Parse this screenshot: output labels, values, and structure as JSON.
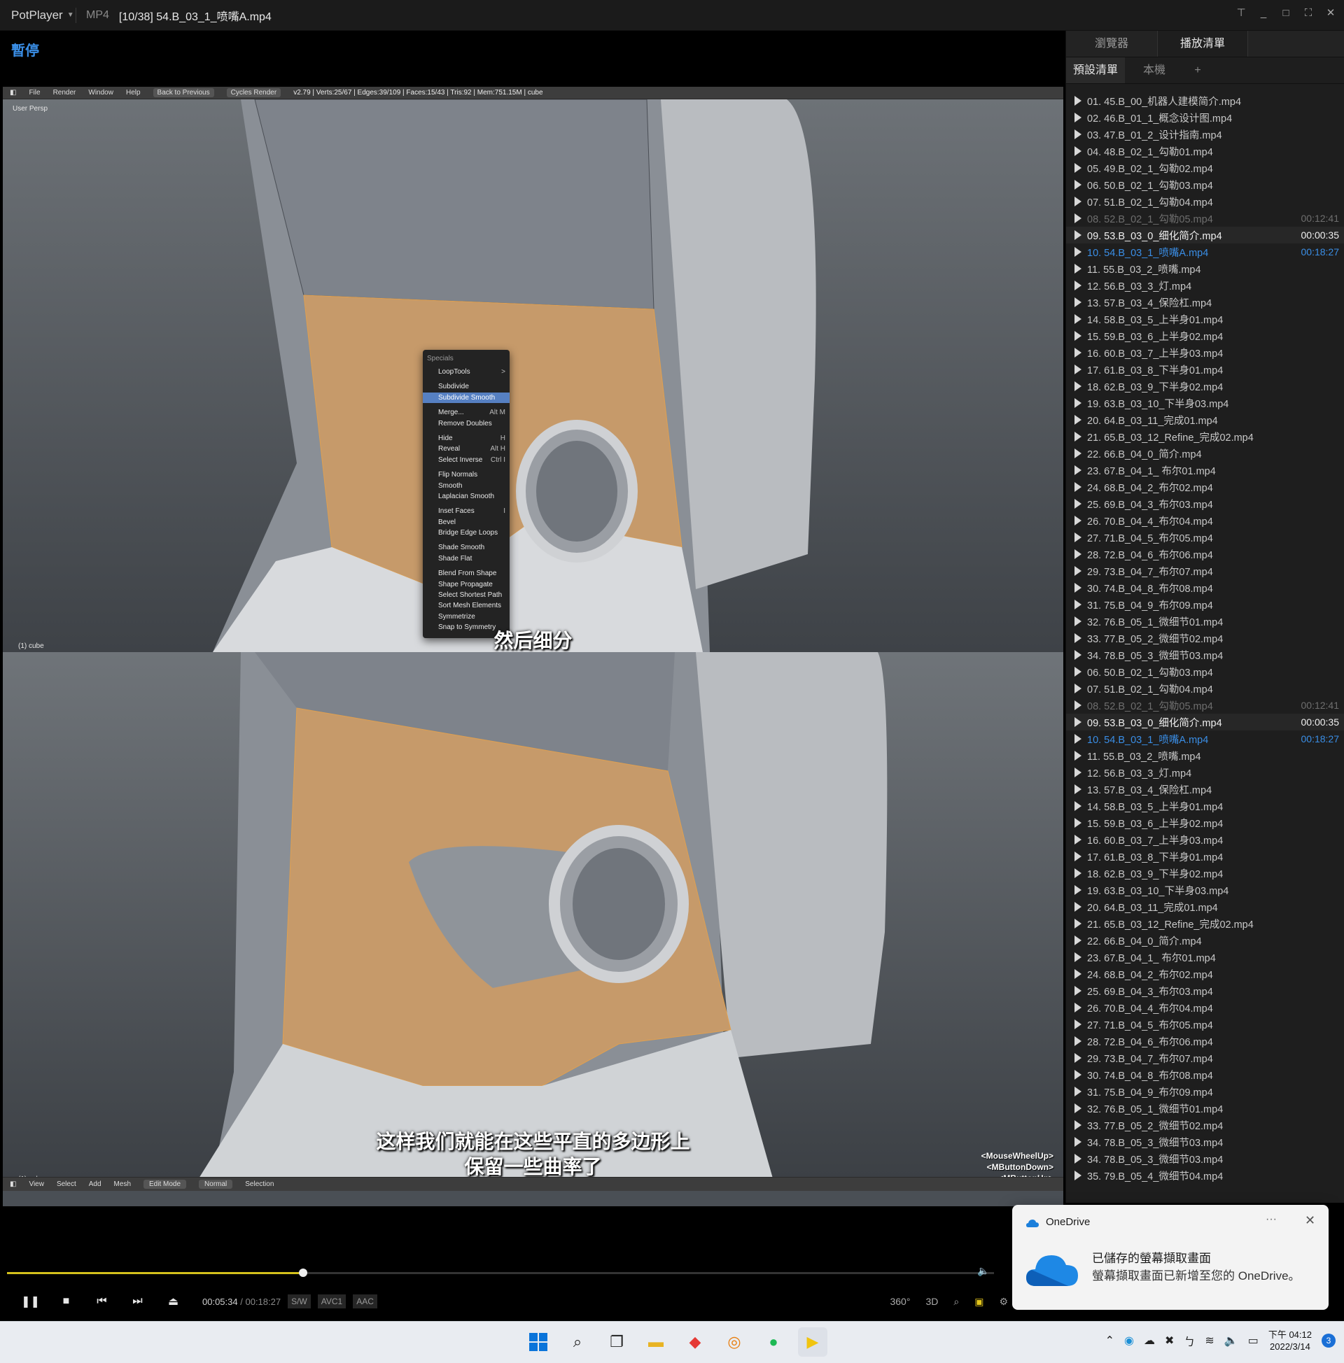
{
  "window": {
    "app_name": "PotPlayer",
    "format": "MP4",
    "title": "[10/38] 54.B_03_1_喷嘴A.mp4"
  },
  "video": {
    "pause_label": "暫停",
    "blender_header": {
      "menus": [
        "File",
        "Render",
        "Window",
        "Help"
      ],
      "back_button": "Back to Previous",
      "render_engine": "Cycles Render",
      "stats": "v2.79 | Verts:25/67 | Edges:39/109 | Faces:15/43 | Tris:92 | Mem:751.15M | cube"
    },
    "viewport_label": "User Persp",
    "object_label": "(1) cube",
    "specials_menu": {
      "title": "Specials",
      "items": [
        {
          "label": "LoopTools",
          "shortcut": ">",
          "gap": false,
          "highlight": false
        },
        {
          "label": "Subdivide",
          "shortcut": "",
          "gap": true,
          "highlight": false
        },
        {
          "label": "Subdivide Smooth",
          "shortcut": "",
          "gap": false,
          "highlight": true
        },
        {
          "label": "Merge...",
          "shortcut": "Alt M",
          "gap": true,
          "highlight": false
        },
        {
          "label": "Remove Doubles",
          "shortcut": "",
          "gap": false,
          "highlight": false
        },
        {
          "label": "Hide",
          "shortcut": "H",
          "gap": true,
          "highlight": false
        },
        {
          "label": "Reveal",
          "shortcut": "Alt H",
          "gap": false,
          "highlight": false
        },
        {
          "label": "Select Inverse",
          "shortcut": "Ctrl I",
          "gap": false,
          "highlight": false
        },
        {
          "label": "Flip Normals",
          "shortcut": "",
          "gap": true,
          "highlight": false
        },
        {
          "label": "Smooth",
          "shortcut": "",
          "gap": false,
          "highlight": false
        },
        {
          "label": "Laplacian Smooth",
          "shortcut": "",
          "gap": false,
          "highlight": false
        },
        {
          "label": "Inset Faces",
          "shortcut": "I",
          "gap": true,
          "highlight": false
        },
        {
          "label": "Bevel",
          "shortcut": "",
          "gap": false,
          "highlight": false
        },
        {
          "label": "Bridge Edge Loops",
          "shortcut": "",
          "gap": false,
          "highlight": false
        },
        {
          "label": "Shade Smooth",
          "shortcut": "",
          "gap": true,
          "highlight": false
        },
        {
          "label": "Shade Flat",
          "shortcut": "",
          "gap": false,
          "highlight": false
        },
        {
          "label": "Blend From Shape",
          "shortcut": "",
          "gap": true,
          "highlight": false
        },
        {
          "label": "Shape Propagate",
          "shortcut": "",
          "gap": false,
          "highlight": false
        },
        {
          "label": "Select Shortest Path",
          "shortcut": "",
          "gap": false,
          "highlight": false
        },
        {
          "label": "Sort Mesh Elements",
          "shortcut": "",
          "gap": false,
          "highlight": false
        },
        {
          "label": "Symmetrize",
          "shortcut": "",
          "gap": false,
          "highlight": false
        },
        {
          "label": "Snap to Symmetry",
          "shortcut": "",
          "gap": false,
          "highlight": false
        }
      ]
    },
    "subtitle_top": "然后细分",
    "subtitle_bottom_1": "这样我们就能在这些平直的多边形上",
    "subtitle_bottom_2": "保留一些曲率了",
    "keylog": [
      "<MouseWheelUp>",
      "<MButtonDown>",
      "<MButtonUp>"
    ],
    "blender_footer": {
      "items": [
        "View",
        "Select",
        "Add",
        "Mesh"
      ],
      "mode": "Edit Mode",
      "orientation": "Normal",
      "selection": "Selection"
    }
  },
  "sidebar": {
    "tabs": [
      "瀏覽器",
      "播放清單"
    ],
    "sub_tabs": [
      "預設清單",
      "本機",
      "+"
    ],
    "playlist": [
      {
        "name": "01. 45.B_00_机器人建模简介.mp4",
        "dur": "",
        "state": ""
      },
      {
        "name": "02. 46.B_01_1_概念设计图.mp4",
        "dur": "",
        "state": ""
      },
      {
        "name": "03. 47.B_01_2_设计指南.mp4",
        "dur": "",
        "state": ""
      },
      {
        "name": "04. 48.B_02_1_勾勒01.mp4",
        "dur": "",
        "state": ""
      },
      {
        "name": "05. 49.B_02_1_勾勒02.mp4",
        "dur": "",
        "state": ""
      },
      {
        "name": "06. 50.B_02_1_勾勒03.mp4",
        "dur": "",
        "state": ""
      },
      {
        "name": "07. 51.B_02_1_勾勒04.mp4",
        "dur": "",
        "state": ""
      },
      {
        "name": "08. 52.B_02_1_勾勒05.mp4",
        "dur": "00:12:41",
        "state": "dim"
      },
      {
        "name": "09. 53.B_03_0_细化简介.mp4",
        "dur": "00:00:35",
        "state": "hi"
      },
      {
        "name": "10. 54.B_03_1_喷嘴A.mp4",
        "dur": "00:18:27",
        "state": "cur"
      },
      {
        "name": "11. 55.B_03_2_喷嘴.mp4",
        "dur": "",
        "state": ""
      },
      {
        "name": "12. 56.B_03_3_灯.mp4",
        "dur": "",
        "state": ""
      },
      {
        "name": "13. 57.B_03_4_保险杠.mp4",
        "dur": "",
        "state": ""
      },
      {
        "name": "14. 58.B_03_5_上半身01.mp4",
        "dur": "",
        "state": ""
      },
      {
        "name": "15. 59.B_03_6_上半身02.mp4",
        "dur": "",
        "state": ""
      },
      {
        "name": "16. 60.B_03_7_上半身03.mp4",
        "dur": "",
        "state": ""
      },
      {
        "name": "17. 61.B_03_8_下半身01.mp4",
        "dur": "",
        "state": ""
      },
      {
        "name": "18. 62.B_03_9_下半身02.mp4",
        "dur": "",
        "state": ""
      },
      {
        "name": "19. 63.B_03_10_下半身03.mp4",
        "dur": "",
        "state": ""
      },
      {
        "name": "20. 64.B_03_11_完成01.mp4",
        "dur": "",
        "state": ""
      },
      {
        "name": "21. 65.B_03_12_Refine_完成02.mp4",
        "dur": "",
        "state": ""
      },
      {
        "name": "22. 66.B_04_0_简介.mp4",
        "dur": "",
        "state": ""
      },
      {
        "name": "23. 67.B_04_1_ 布尔01.mp4",
        "dur": "",
        "state": ""
      },
      {
        "name": "24. 68.B_04_2_布尔02.mp4",
        "dur": "",
        "state": ""
      },
      {
        "name": "25. 69.B_04_3_布尔03.mp4",
        "dur": "",
        "state": ""
      },
      {
        "name": "26. 70.B_04_4_布尔04.mp4",
        "dur": "",
        "state": ""
      },
      {
        "name": "27. 71.B_04_5_布尔05.mp4",
        "dur": "",
        "state": ""
      },
      {
        "name": "28. 72.B_04_6_布尔06.mp4",
        "dur": "",
        "state": ""
      },
      {
        "name": "29. 73.B_04_7_布尔07.mp4",
        "dur": "",
        "state": ""
      },
      {
        "name": "30. 74.B_04_8_布尔08.mp4",
        "dur": "",
        "state": ""
      },
      {
        "name": "31. 75.B_04_9_布尔09.mp4",
        "dur": "",
        "state": ""
      },
      {
        "name": "32. 76.B_05_1_微细节01.mp4",
        "dur": "",
        "state": ""
      },
      {
        "name": "33. 77.B_05_2_微细节02.mp4",
        "dur": "",
        "state": ""
      },
      {
        "name": "34. 78.B_05_3_微细节03.mp4",
        "dur": "",
        "state": ""
      },
      {
        "name": "06. 50.B_02_1_勾勒03.mp4",
        "dur": "",
        "state": ""
      },
      {
        "name": "07. 51.B_02_1_勾勒04.mp4",
        "dur": "",
        "state": ""
      },
      {
        "name": "08. 52.B_02_1_勾勒05.mp4",
        "dur": "00:12:41",
        "state": "dim"
      },
      {
        "name": "09. 53.B_03_0_细化简介.mp4",
        "dur": "00:00:35",
        "state": "hi"
      },
      {
        "name": "10. 54.B_03_1_喷嘴A.mp4",
        "dur": "00:18:27",
        "state": "cur"
      },
      {
        "name": "11. 55.B_03_2_喷嘴.mp4",
        "dur": "",
        "state": ""
      },
      {
        "name": "12. 56.B_03_3_灯.mp4",
        "dur": "",
        "state": ""
      },
      {
        "name": "13. 57.B_03_4_保险杠.mp4",
        "dur": "",
        "state": ""
      },
      {
        "name": "14. 58.B_03_5_上半身01.mp4",
        "dur": "",
        "state": ""
      },
      {
        "name": "15. 59.B_03_6_上半身02.mp4",
        "dur": "",
        "state": ""
      },
      {
        "name": "16. 60.B_03_7_上半身03.mp4",
        "dur": "",
        "state": ""
      },
      {
        "name": "17. 61.B_03_8_下半身01.mp4",
        "dur": "",
        "state": ""
      },
      {
        "name": "18. 62.B_03_9_下半身02.mp4",
        "dur": "",
        "state": ""
      },
      {
        "name": "19. 63.B_03_10_下半身03.mp4",
        "dur": "",
        "state": ""
      },
      {
        "name": "20. 64.B_03_11_完成01.mp4",
        "dur": "",
        "state": ""
      },
      {
        "name": "21. 65.B_03_12_Refine_完成02.mp4",
        "dur": "",
        "state": ""
      },
      {
        "name": "22. 66.B_04_0_简介.mp4",
        "dur": "",
        "state": ""
      },
      {
        "name": "23. 67.B_04_1_ 布尔01.mp4",
        "dur": "",
        "state": ""
      },
      {
        "name": "24. 68.B_04_2_布尔02.mp4",
        "dur": "",
        "state": ""
      },
      {
        "name": "25. 69.B_04_3_布尔03.mp4",
        "dur": "",
        "state": ""
      },
      {
        "name": "26. 70.B_04_4_布尔04.mp4",
        "dur": "",
        "state": ""
      },
      {
        "name": "27. 71.B_04_5_布尔05.mp4",
        "dur": "",
        "state": ""
      },
      {
        "name": "28. 72.B_04_6_布尔06.mp4",
        "dur": "",
        "state": ""
      },
      {
        "name": "29. 73.B_04_7_布尔07.mp4",
        "dur": "",
        "state": ""
      },
      {
        "name": "30. 74.B_04_8_布尔08.mp4",
        "dur": "",
        "state": ""
      },
      {
        "name": "31. 75.B_04_9_布尔09.mp4",
        "dur": "",
        "state": ""
      },
      {
        "name": "32. 76.B_05_1_微细节01.mp4",
        "dur": "",
        "state": ""
      },
      {
        "name": "33. 77.B_05_2_微细节02.mp4",
        "dur": "",
        "state": ""
      },
      {
        "name": "34. 78.B_05_3_微细节03.mp4",
        "dur": "",
        "state": ""
      },
      {
        "name": "34. 78.B_05_3_微细节03.mp4",
        "dur": "",
        "state": ""
      },
      {
        "name": "35. 79.B_05_4_微细节04.mp4",
        "dur": "",
        "state": ""
      }
    ]
  },
  "player": {
    "progress": 0.3,
    "current_time": "00:05:34",
    "separator": "/",
    "total_time": "00:18:27",
    "badges": [
      "S/W",
      "AVC1",
      "AAC"
    ],
    "right_controls": [
      "360°",
      "3D"
    ],
    "accent_color": "#d4c11c"
  },
  "toast": {
    "app": "OneDrive",
    "more": "···",
    "close": "✕",
    "heading": "已儲存的螢幕擷取畫面",
    "body": "螢幕擷取畫面已新增至您的 OneDrive。"
  },
  "taskbar": {
    "time": "下午 04:12",
    "date": "2022/3/14",
    "notifications": "3"
  }
}
